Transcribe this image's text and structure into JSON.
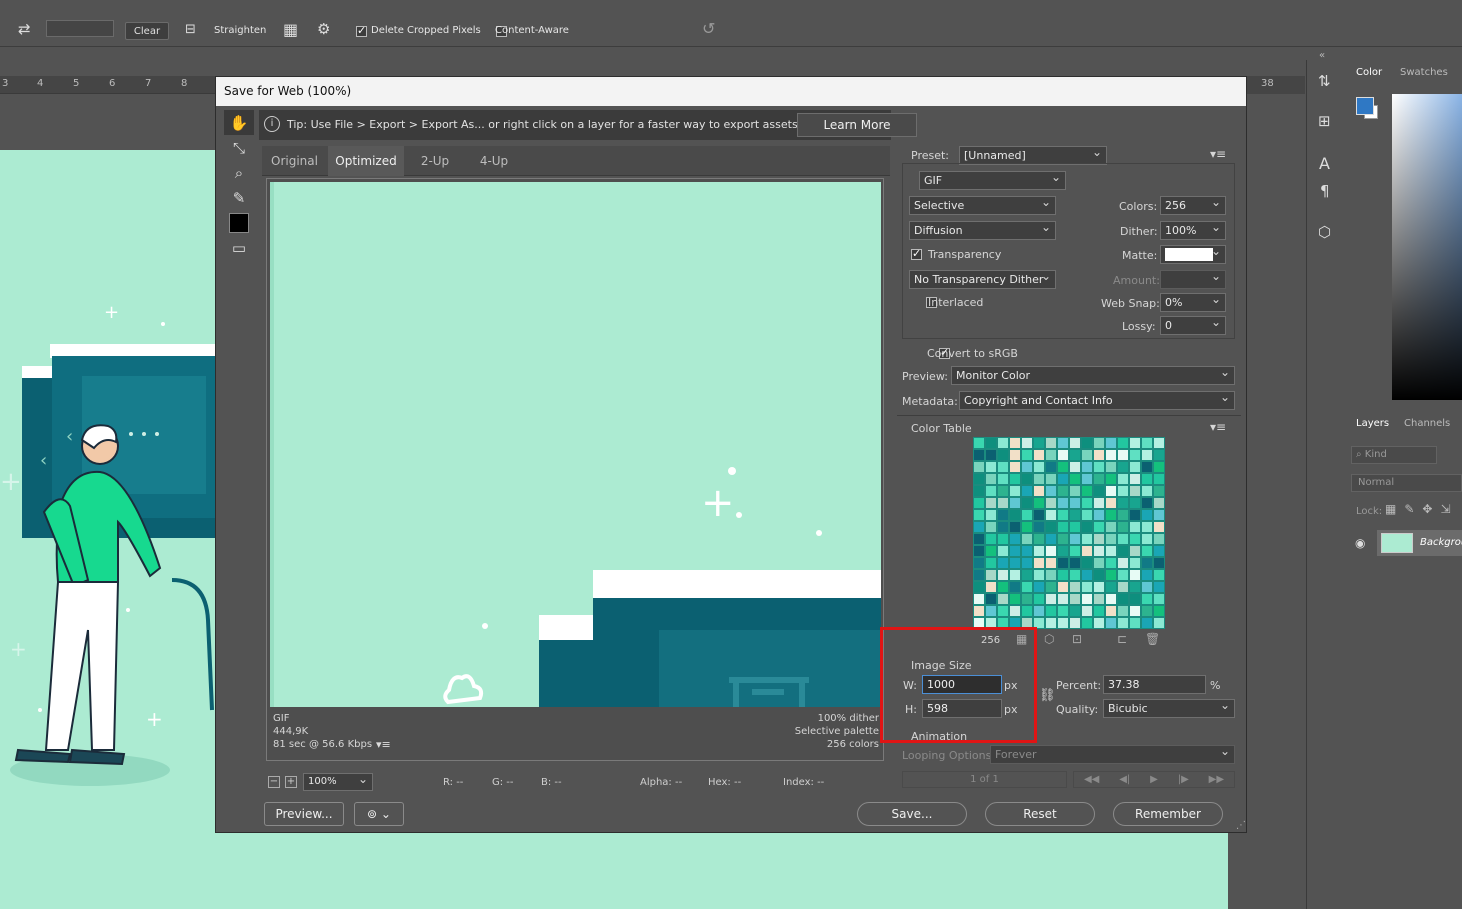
{
  "optbar": {
    "clear_label": "Clear",
    "straighten_label": "Straighten",
    "delete_cropped_label": "Delete Cropped Pixels",
    "delete_cropped_checked": true,
    "content_aware_label": "Content-Aware",
    "content_aware_checked": false
  },
  "ruler": {
    "ticks": [
      "3",
      "4",
      "5",
      "6",
      "7",
      "8"
    ],
    "right_tick": "38"
  },
  "panels": {
    "color_tab": "Color",
    "swatches_tab": "Swatches",
    "layers_tab": "Layers",
    "channels_tab": "Channels",
    "kind_placeholder": "Kind",
    "blend_mode": "Normal",
    "lock_label": "Lock:",
    "layer_name": "Backgrou"
  },
  "dialog": {
    "title": "Save for Web (100%)",
    "tip": "Tip: Use File > Export > Export As...  or right click on a layer for a faster way to export assets",
    "learn_more": "Learn More",
    "tabs": [
      "Original",
      "Optimized",
      "2-Up",
      "4-Up"
    ],
    "active_tab": "Optimized",
    "preview_info_left": [
      "GIF",
      "444,9K",
      "81 sec @ 56.6 Kbps"
    ],
    "preview_info_right": [
      "100% dither",
      "Selective palette",
      "256 colors"
    ],
    "zoom": "100%",
    "status": {
      "r": "R: --",
      "g": "G: --",
      "b": "B: --",
      "alpha": "Alpha: --",
      "hex": "Hex: --",
      "index": "Index: --"
    },
    "buttons": {
      "preview": "Preview...",
      "save": "Save...",
      "reset": "Reset",
      "remember": "Remember"
    },
    "settings": {
      "preset_label": "Preset:",
      "preset_value": "[Unnamed]",
      "format": "GIF",
      "reduction": "Selective",
      "dither_algo": "Diffusion",
      "transparency_label": "Transparency",
      "transparency_checked": true,
      "transparency_dither": "No Transparency Dither",
      "interlaced_label": "Interlaced",
      "interlaced_checked": false,
      "colors_label": "Colors:",
      "colors_value": "256",
      "dither_label": "Dither:",
      "dither_value": "100%",
      "matte_label": "Matte:",
      "amount_label": "Amount:",
      "websnap_label": "Web Snap:",
      "websnap_value": "0%",
      "lossy_label": "Lossy:",
      "lossy_value": "0",
      "srgb_label": "Convert to sRGB",
      "srgb_checked": true,
      "preview_label": "Preview:",
      "preview_value": "Monitor Color",
      "metadata_label": "Metadata:",
      "metadata_value": "Copyright and Contact Info",
      "color_table_label": "Color Table",
      "color_count": "256"
    },
    "image_size": {
      "title": "Image Size",
      "w_label": "W:",
      "w_value": "1000",
      "h_label": "H:",
      "h_value": "598",
      "unit": "px",
      "percent_label": "Percent:",
      "percent_value": "37.38",
      "percent_unit": "%",
      "quality_label": "Quality:",
      "quality_value": "Bicubic"
    },
    "animation": {
      "title": "Animation",
      "looping_label": "Looping Options:",
      "looping_value": "Forever",
      "frame": "1 of 1"
    }
  },
  "colors": {
    "accent_blue": "#2f78c4",
    "highlight_red": "#e01414",
    "canvas_mint": "#acebd2",
    "teal_dark": "#0b6071"
  }
}
